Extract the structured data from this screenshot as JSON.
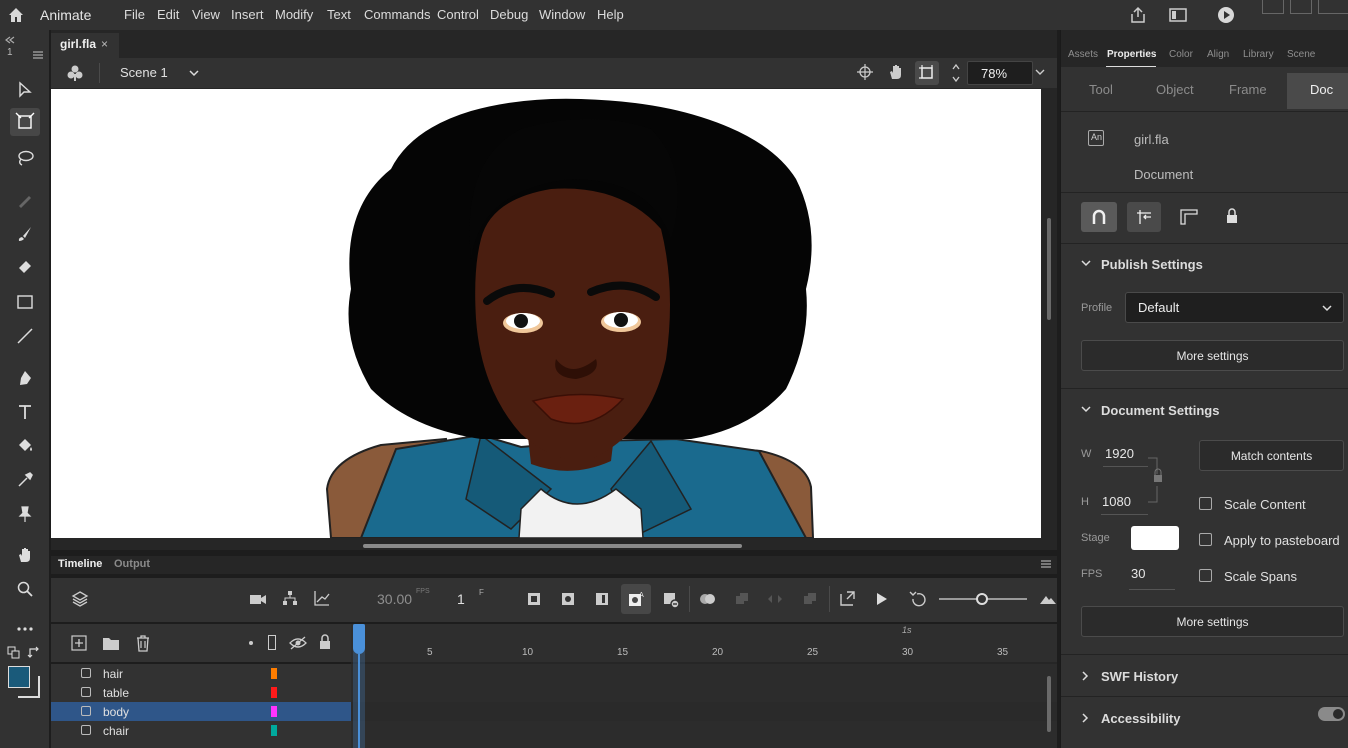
{
  "app": {
    "name": "Animate"
  },
  "menu": [
    "File",
    "Edit",
    "View",
    "Insert",
    "Modify",
    "Text",
    "Commands",
    "Control",
    "Debug",
    "Window",
    "Help"
  ],
  "left_frame_indicator": {
    "num": "1"
  },
  "document": {
    "tab_name": "girl.fla",
    "close_glyph": "×"
  },
  "scene": {
    "label": "Scene 1"
  },
  "zoom": {
    "value": "78%"
  },
  "timeline": {
    "tabs": [
      "Timeline",
      "Output"
    ],
    "fps": "30.00",
    "fps_unit": "FPS",
    "frame": "1",
    "frame_unit": "F",
    "ruler_marks": [
      "5",
      "10",
      "15",
      "20",
      "25",
      "30",
      "35"
    ],
    "seconds_label": "1s",
    "layers": [
      {
        "name": "hair",
        "color": "#ff7d00",
        "selected": false
      },
      {
        "name": "table",
        "color": "#ff1a1a",
        "selected": false
      },
      {
        "name": "body",
        "color": "#ff33ff",
        "selected": true
      },
      {
        "name": "chair",
        "color": "#00a99d",
        "selected": false
      }
    ]
  },
  "panel": {
    "tabs": [
      "Assets",
      "Properties",
      "Color",
      "Align",
      "Library",
      "Scene"
    ],
    "active_tab": "Properties",
    "subtabs": [
      "Tool",
      "Object",
      "Frame",
      "Doc"
    ],
    "active_subtab": "Doc",
    "doc_name": "girl.fla",
    "doc_type": "Document",
    "doc_icon": "An",
    "publish": {
      "title": "Publish Settings",
      "profile_label": "Profile",
      "profile_value": "Default",
      "more_label": "More settings"
    },
    "doc_settings": {
      "title": "Document Settings",
      "w_label": "W",
      "w_value": "1920",
      "h_label": "H",
      "h_value": "1080",
      "match_label": "Match contents",
      "scale_content": "Scale Content",
      "apply_pasteboard": "Apply to pasteboard",
      "stage_label": "Stage",
      "stage_color": "#ffffff",
      "fps_label": "FPS",
      "fps_value": "30",
      "scale_spans": "Scale Spans",
      "more_label": "More settings"
    },
    "swf_history": "SWF History",
    "accessibility": "Accessibility"
  },
  "colors": {
    "fill": "#1a5a7a",
    "accent": "#2f5689",
    "playhead": "#4a90d9"
  }
}
